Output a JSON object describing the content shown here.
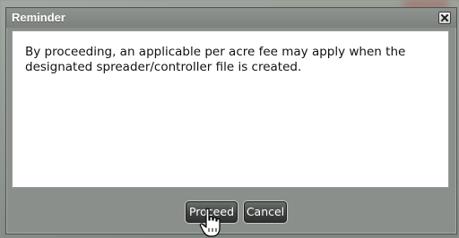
{
  "dialog": {
    "title": "Reminder",
    "message": "By proceeding, an applicable per acre fee may apply when the\ndesignated spreader/controller file is created.",
    "buttons": {
      "proceed_label": "Proceed",
      "cancel_label": "Cancel"
    },
    "close_icon": "close-icon"
  },
  "cursor": {
    "icon": "hand-pointer-icon"
  },
  "colors": {
    "header": "#848985",
    "body": "#ffffff",
    "button": "#3f4340",
    "button_text": "#ffffff"
  }
}
